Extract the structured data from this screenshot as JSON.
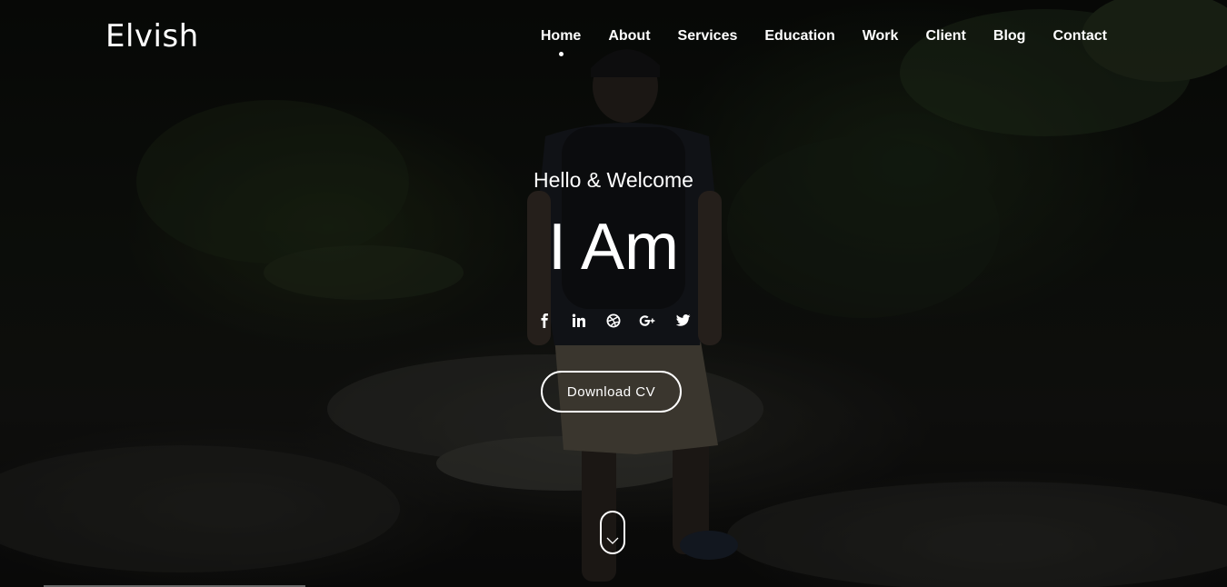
{
  "brand": {
    "name": "Elvish"
  },
  "nav": {
    "items": [
      {
        "label": "Home",
        "active": true
      },
      {
        "label": "About"
      },
      {
        "label": "Services"
      },
      {
        "label": "Education"
      },
      {
        "label": "Work"
      },
      {
        "label": "Client"
      },
      {
        "label": "Blog"
      },
      {
        "label": "Contact"
      }
    ]
  },
  "hero": {
    "greeting": "Hello & Welcome",
    "headline": "I Am",
    "socials": [
      {
        "icon": "facebook-icon",
        "glyph": "f"
      },
      {
        "icon": "linkedin-icon",
        "glyph": "in"
      },
      {
        "icon": "dribbble-icon",
        "glyph": ""
      },
      {
        "icon": "google-plus-icon",
        "glyph": "G+"
      },
      {
        "icon": "twitter-icon",
        "glyph": ""
      }
    ],
    "cta_label": "Download CV",
    "scroll_icon": "chevron-down-icon"
  },
  "colors": {
    "text": "#ffffff",
    "background": "#0d0f0c"
  }
}
